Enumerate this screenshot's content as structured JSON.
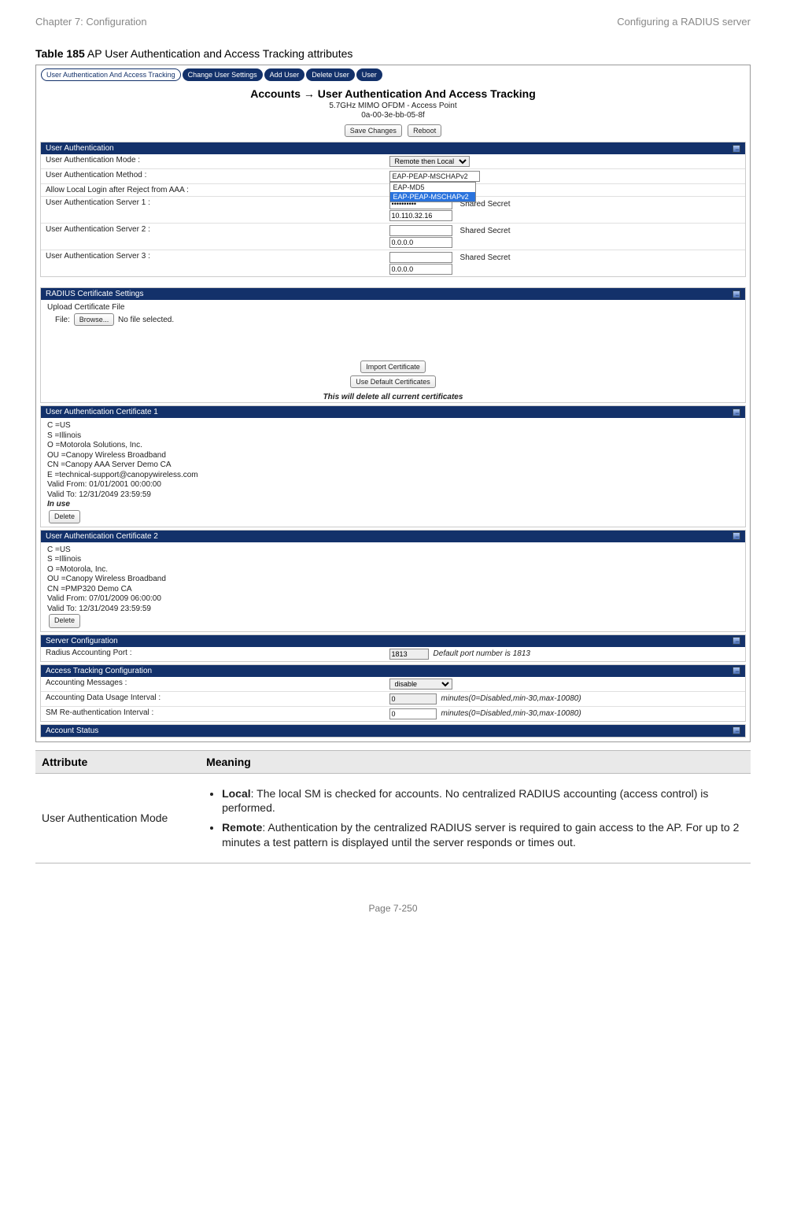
{
  "header": {
    "left": "Chapter 7:  Configuration",
    "right": "Configuring a RADIUS server"
  },
  "caption": {
    "bold": "Table 185",
    "rest": " AP User Authentication and Access Tracking attributes"
  },
  "tabs": {
    "active": "User Authentication And Access Tracking",
    "items": [
      "Change User Settings",
      "Add User",
      "Delete User",
      "User"
    ]
  },
  "page": {
    "title": "Accounts → User Authentication And Access Tracking",
    "sub1": "5.7GHz MIMO OFDM - Access Point",
    "sub2": "0a-00-3e-bb-05-8f",
    "save": "Save Changes",
    "reboot": "Reboot"
  },
  "ua": {
    "hdr": "User Authentication",
    "mode_l": "User Authentication Mode :",
    "mode_v": "Remote then Local",
    "method_l": "User Authentication Method :",
    "method_v": "EAP-PEAP-MSCHAPv2",
    "method_opts": [
      "EAP-MD5",
      "EAP-PEAP-MSCHAPv2"
    ],
    "allow_l": "Allow Local Login after Reject from AAA :",
    "s1_l": "User Authentication Server 1 :",
    "s1_pw": "••••••••••",
    "s1_ss": "Shared Secret",
    "s1_ip": "10.110.32.16",
    "s2_l": "User Authentication Server 2 :",
    "s2_ss": "Shared Secret",
    "s2_ip": "0.0.0.0",
    "s3_l": "User Authentication Server 3 :",
    "s3_ss": "Shared Secret",
    "s3_ip": "0.0.0.0"
  },
  "rcs": {
    "hdr": "RADIUS Certificate Settings",
    "upload": "Upload Certificate File",
    "file": "File:",
    "browse": "Browse...",
    "nofile": "No file selected.",
    "import": "Import Certificate",
    "usedef": "Use Default Certificates",
    "note": "This will delete all current certificates"
  },
  "c1": {
    "hdr": "User Authentication Certificate 1",
    "lines": [
      "C =US",
      "S =Illinois",
      "O =Motorola Solutions, Inc.",
      "OU =Canopy Wireless Broadband",
      "CN =Canopy AAA Server Demo CA",
      "E =technical-support@canopywireless.com",
      "Valid From: 01/01/2001 00:00:00",
      "Valid To: 12/31/2049 23:59:59"
    ],
    "inuse": "In use",
    "del": "Delete"
  },
  "c2": {
    "hdr": "User Authentication Certificate 2",
    "lines": [
      "C =US",
      "S =Illinois",
      "O =Motorola, Inc.",
      "OU =Canopy Wireless Broadband",
      "CN =PMP320 Demo CA",
      "Valid From: 07/01/2009 06:00:00",
      "Valid To: 12/31/2049 23:59:59"
    ],
    "del": "Delete"
  },
  "sc": {
    "hdr": "Server Configuration",
    "port_l": "Radius Accounting Port :",
    "port_v": "1813",
    "port_note": "Default port number is 1813"
  },
  "atc": {
    "hdr": "Access Tracking Configuration",
    "am_l": "Accounting Messages :",
    "am_v": "disable",
    "du_l": "Accounting Data Usage Interval :",
    "du_v": "0",
    "du_note": "minutes(0=Disabled,min-30,max-10080)",
    "ri_l": "SM Re-authentication Interval :",
    "ri_v": "0",
    "ri_note": "minutes(0=Disabled,min-30,max-10080)"
  },
  "as": {
    "hdr": "Account Status"
  },
  "table": {
    "th1": "Attribute",
    "th2": "Meaning",
    "r1_attr": "User Authentication Mode",
    "r1_b1": "Local",
    "r1_t1": ": The local SM is checked for accounts. No centralized RADIUS accounting (access control) is performed.",
    "r1_b2": "Remote",
    "r1_t2": ": Authentication by the centralized RADIUS server is required to gain access to the AP. For up to 2 minutes a test pattern is displayed until the server responds or times out."
  },
  "footer": "Page 7-250"
}
